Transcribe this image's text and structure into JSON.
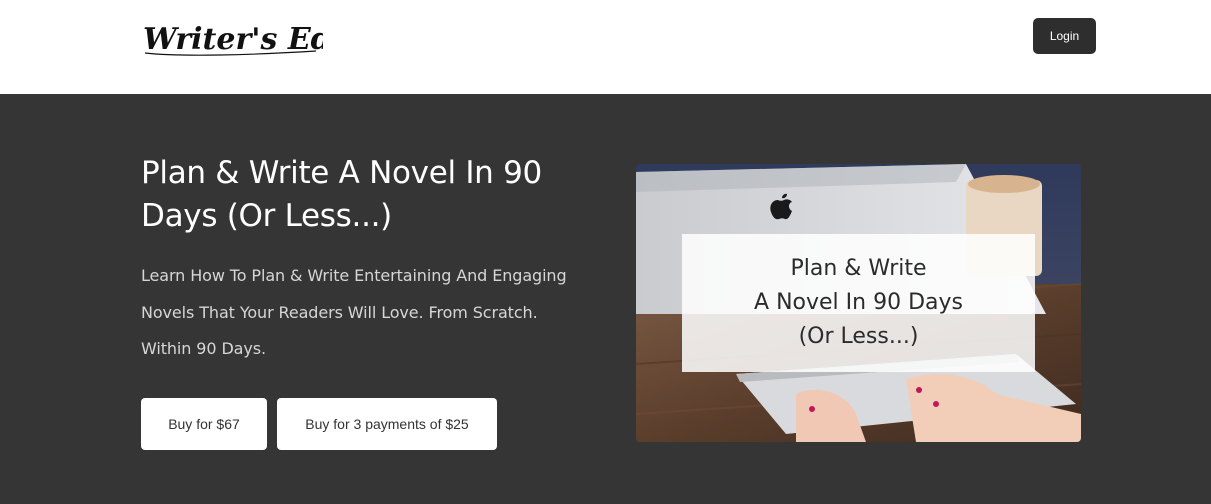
{
  "header": {
    "logo_text": "Writer's Edit",
    "login_label": "Login"
  },
  "hero": {
    "title": "Plan & Write A Novel In 90 Days (Or Less...)",
    "subtitle": "Learn How To Plan & Write Entertaining And Engaging Novels That Your Readers Will Love. From Scratch. Within 90 Days.",
    "buttons": {
      "buy_full": "Buy for $67",
      "buy_installments": "Buy for 3 payments of $25"
    },
    "image": {
      "line1": "Plan & Write",
      "line2": "A Novel In 90 Days",
      "line3": "(Or Less...)"
    }
  },
  "colors": {
    "hero_background": "#353535",
    "header_background": "#ffffff",
    "login_button": "#2e2e2e",
    "button_background": "#ffffff"
  },
  "icons": {
    "logo": "writers-edit-logo",
    "image_apple": "apple-logo-icon"
  }
}
